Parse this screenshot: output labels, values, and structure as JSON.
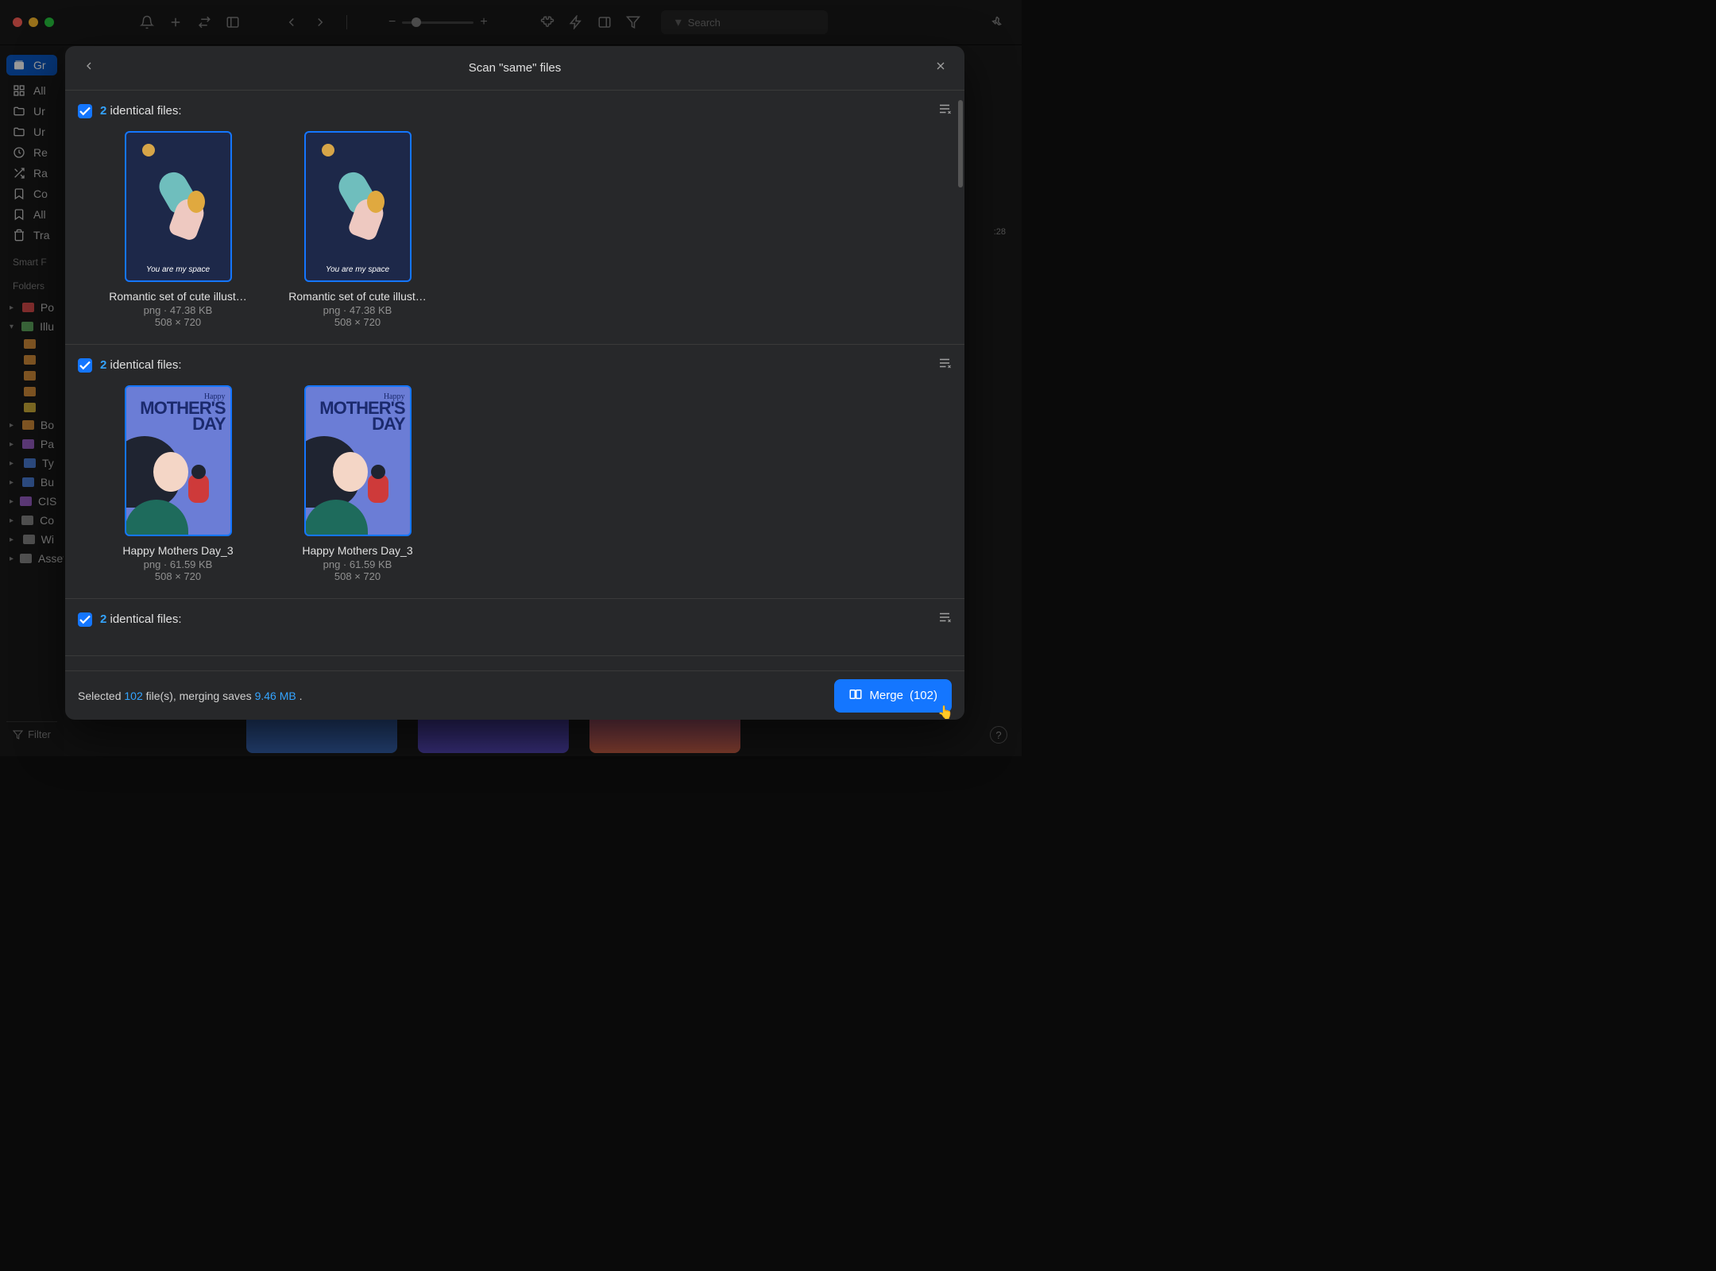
{
  "titlebar": {
    "search_placeholder": "Search"
  },
  "sidebar": {
    "lib_label": "Gr",
    "items": [
      {
        "icon": "grid",
        "label": "All"
      },
      {
        "icon": "folder",
        "label": "Ur"
      },
      {
        "icon": "folder",
        "label": "Ur"
      },
      {
        "icon": "clock",
        "label": "Re"
      },
      {
        "icon": "shuffle",
        "label": "Ra"
      },
      {
        "icon": "bookmark",
        "label": "Co"
      },
      {
        "icon": "bookmark",
        "label": "All"
      },
      {
        "icon": "trash",
        "label": "Tra"
      }
    ],
    "smart_label": "Smart F",
    "folders_label": "Folders",
    "folders": [
      {
        "color": "f-red",
        "label": "Po",
        "disclosure": "▸"
      },
      {
        "color": "f-green",
        "label": "Illu",
        "disclosure": "▾",
        "expanded": true
      },
      {
        "color": "f-orange",
        "label": "Bo",
        "disclosure": "▸"
      },
      {
        "color": "f-purple",
        "label": "Pa",
        "disclosure": "▸"
      },
      {
        "color": "f-blue",
        "label": "Ty",
        "disclosure": "▸"
      },
      {
        "color": "f-blue",
        "label": "Bu",
        "disclosure": "▸"
      },
      {
        "color": "f-purple",
        "label": "CIS",
        "disclosure": "▸"
      },
      {
        "color": "f-grey",
        "label": "Co",
        "disclosure": "▸"
      },
      {
        "color": "f-grey",
        "label": "Wi",
        "disclosure": "▸"
      },
      {
        "color": "f-grey",
        "label": "Assets",
        "disclosure": "▸"
      }
    ],
    "subfolders": [
      {
        "color": "f-orange"
      },
      {
        "color": "f-orange"
      },
      {
        "color": "f-orange"
      },
      {
        "color": "f-orange"
      },
      {
        "color": "f-yellow"
      }
    ],
    "filter_placeholder": "Filter"
  },
  "modal": {
    "title": "Scan \"same\" files",
    "groups": [
      {
        "count": 2,
        "label_suffix": "identical files:",
        "dupes": [
          {
            "name": "Romantic set of cute illust…",
            "ext": "png",
            "size": "47.38 KB",
            "dim": "508 × 720",
            "kind": "space",
            "caption": "You are my space"
          },
          {
            "name": "Romantic set of cute illust…",
            "ext": "png",
            "size": "47.38 KB",
            "dim": "508 × 720",
            "kind": "space",
            "caption": "You are my space"
          }
        ]
      },
      {
        "count": 2,
        "label_suffix": "identical files:",
        "dupes": [
          {
            "name": "Happy Mothers Day_3",
            "ext": "png",
            "size": "61.59 KB",
            "dim": "508 × 720",
            "kind": "mother",
            "happy": "Happy",
            "big1": "MOTHER'S",
            "big2": "DAY"
          },
          {
            "name": "Happy Mothers Day_3",
            "ext": "png",
            "size": "61.59 KB",
            "dim": "508 × 720",
            "kind": "mother",
            "happy": "Happy",
            "big1": "MOTHER'S",
            "big2": "DAY"
          }
        ]
      },
      {
        "count": 2,
        "label_suffix": "identical files:",
        "dupes": []
      }
    ],
    "footer": {
      "selected_prefix": "Selected",
      "selected_count": "102",
      "files_label": "file(s), merging saves",
      "saves_size": "9.46 MB",
      "period": ".",
      "merge_label": "Merge",
      "merge_count": "(102)"
    }
  },
  "right": {
    "time": ":28"
  }
}
